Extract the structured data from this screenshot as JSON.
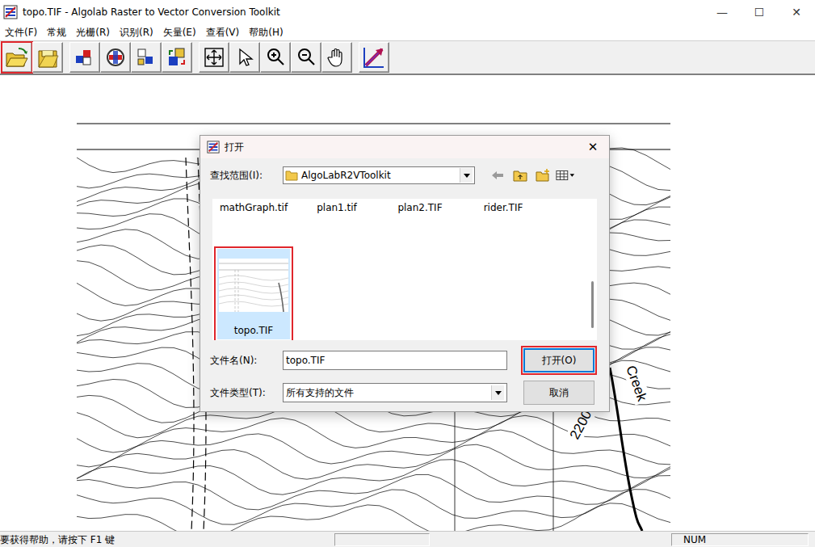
{
  "window": {
    "title": "topo.TIF - Algolab Raster to Vector Conversion Toolkit",
    "controls": [
      "—",
      "☐",
      "✕"
    ]
  },
  "menu": [
    "文件(F)",
    "常规",
    "光栅(R)",
    "识别(R)",
    "矢量(E)",
    "查看(V)",
    "帮助(H)"
  ],
  "toolbar": [
    [
      {
        "kind": "open",
        "highlighted": true
      },
      {
        "kind": "save",
        "highlighted": false
      }
    ],
    [
      {
        "kind": "raster-a",
        "highlighted": false
      },
      {
        "kind": "raster-b",
        "highlighted": false
      },
      {
        "kind": "raster-c",
        "highlighted": false
      },
      {
        "kind": "raster-d",
        "highlighted": false
      }
    ],
    [
      {
        "kind": "fit",
        "highlighted": false
      },
      {
        "kind": "pointer",
        "highlighted": false
      },
      {
        "kind": "zoom-in",
        "highlighted": false
      },
      {
        "kind": "zoom-out",
        "highlighted": false
      },
      {
        "kind": "hand",
        "highlighted": false
      }
    ],
    [
      {
        "kind": "vectorize",
        "highlighted": false
      }
    ]
  ],
  "map": {
    "labels": [
      "Creek",
      "2200"
    ]
  },
  "dialog": {
    "title": "打开",
    "close": "✕",
    "look_in_label": "查找范围(I):",
    "folder": "AlgoLabR2VToolkit",
    "files": [
      {
        "name": "mathGraph.tif",
        "selected": false,
        "highlighted": false
      },
      {
        "name": "plan1.tif",
        "selected": false,
        "highlighted": false
      },
      {
        "name": "plan2.TIF",
        "selected": false,
        "highlighted": false
      },
      {
        "name": "rider.TIF",
        "selected": false,
        "highlighted": false
      },
      {
        "name": "topo.TIF",
        "selected": true,
        "highlighted": true
      }
    ],
    "filename_label": "文件名(N):",
    "filename": "topo.TIF",
    "filetype_label": "文件类型(T):",
    "filetype": "所有支持的文件",
    "buttons": [
      {
        "label": "打开(O)",
        "default": true,
        "highlighted": true
      },
      {
        "label": "取消",
        "default": false,
        "highlighted": false
      }
    ]
  },
  "status_bar": {
    "message": "要获得帮助，请按下 F1 键",
    "indicator": "NUM"
  }
}
